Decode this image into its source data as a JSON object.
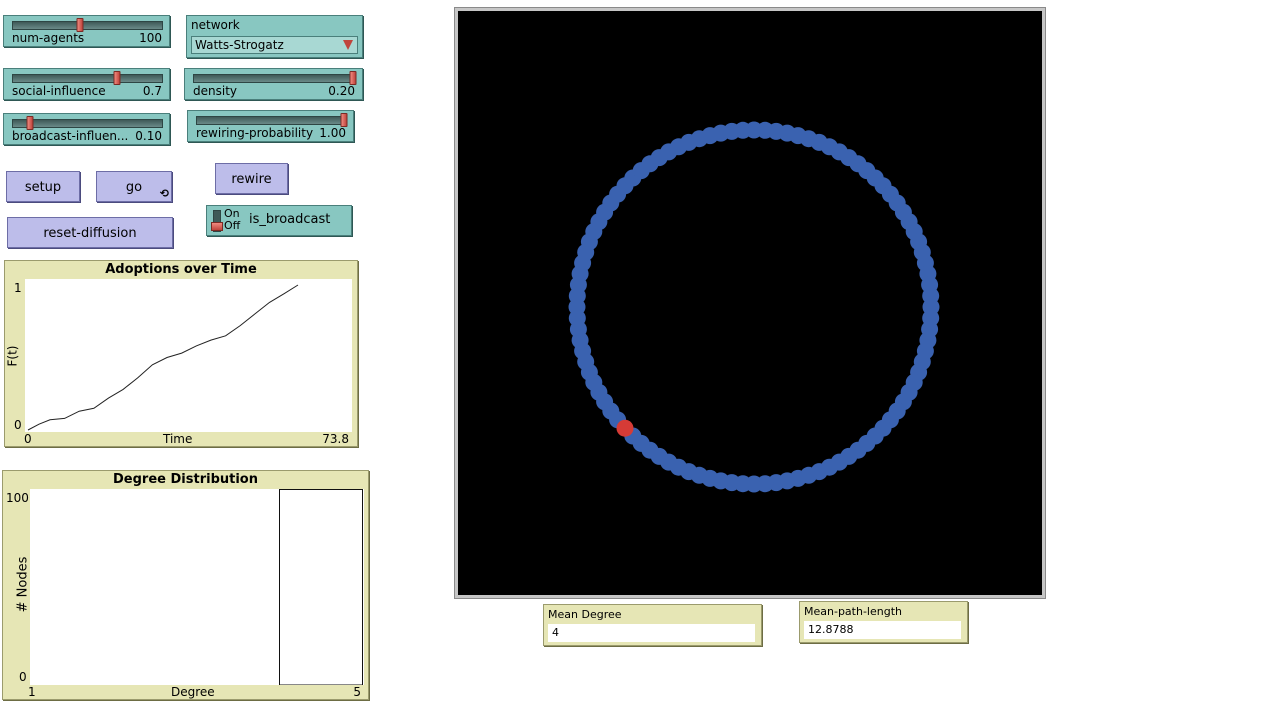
{
  "sliders": [
    {
      "id": "num_agents",
      "label": "num-agents",
      "value": "100",
      "fraction": 0.45
    },
    {
      "id": "social_influence",
      "label": "social-influence",
      "value": "0.7",
      "fraction": 0.7
    },
    {
      "id": "broadcast_influence",
      "label": "broadcast-influen...",
      "value": "0.10",
      "fraction": 0.1
    },
    {
      "id": "density",
      "label": "density",
      "value": "0.20",
      "fraction": 1.0
    },
    {
      "id": "rewiring_probability",
      "label": "rewiring-probability",
      "value": "1.00",
      "fraction": 1.0
    }
  ],
  "chooser": {
    "label": "network",
    "value": "Watts-Strogatz"
  },
  "buttons": {
    "setup": "setup",
    "go": "go",
    "reset_diffusion": "reset-diffusion",
    "rewire": "rewire"
  },
  "switch": {
    "label": "is_broadcast",
    "on": "On",
    "off": "Off",
    "state": "off"
  },
  "plot_adoptions": {
    "title": "Adoptions over Time",
    "xlabel": "Time",
    "ylabel": "F(t)",
    "x_min": "0",
    "x_max": "73.8",
    "y_min": "0",
    "y_max": "1"
  },
  "plot_degree": {
    "title": "Degree Distribution",
    "xlabel": "Degree",
    "ylabel": "# Nodes",
    "x_min": "1",
    "x_max": "5",
    "y_min": "0",
    "y_max": "100"
  },
  "monitors": {
    "mean_degree": {
      "label": "Mean Degree",
      "value": "4"
    },
    "mean_path_length": {
      "label": "Mean-path-length",
      "value": "12.8788"
    }
  },
  "colors": {
    "agent": "#3a62b0",
    "adopter": "#d63b36",
    "view_bg": "#000000"
  },
  "chart_data": [
    {
      "type": "line",
      "title": "Adoptions over Time",
      "xlabel": "Time",
      "ylabel": "F(t)",
      "xlim": [
        0,
        73.8
      ],
      "ylim": [
        0,
        1
      ],
      "series": [
        {
          "x": [
            0,
            3,
            6,
            10,
            14,
            18,
            22,
            26,
            30,
            34,
            38,
            42,
            46,
            50,
            54,
            58,
            62,
            66,
            70,
            73.8
          ],
          "y": [
            0,
            0.04,
            0.07,
            0.08,
            0.13,
            0.15,
            0.22,
            0.28,
            0.36,
            0.45,
            0.5,
            0.53,
            0.58,
            0.62,
            0.65,
            0.72,
            0.8,
            0.88,
            0.94,
            1.0
          ]
        }
      ]
    },
    {
      "type": "bar",
      "title": "Degree Distribution",
      "xlabel": "Degree",
      "ylabel": "# Nodes",
      "xlim": [
        1,
        5
      ],
      "ylim": [
        0,
        100
      ],
      "categories": [
        4
      ],
      "values": [
        100
      ]
    }
  ],
  "network_view": {
    "num_agents": 100,
    "adopters": [
      63
    ]
  }
}
